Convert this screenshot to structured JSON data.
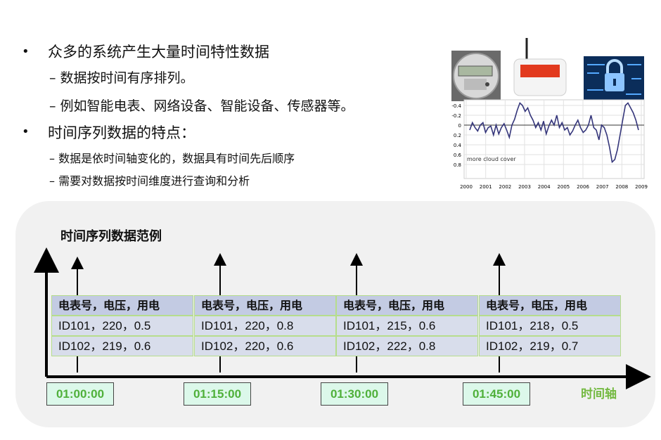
{
  "bullets": [
    {
      "level": 1,
      "text": "众多的系统产生大量时间特性数据"
    },
    {
      "level": 2,
      "text": "– 数据按时间有序排列。"
    },
    {
      "level": 2,
      "text": "– 例如智能电表、网络设备、智能设备、传感器等。"
    },
    {
      "level": 1,
      "text": "时间序列数据的特点："
    },
    {
      "level": 3,
      "text": "– 数据是依时间轴变化的，数据具有时间先后顺序"
    },
    {
      "level": 3,
      "text": "– 需要对数据按时间维度进行查询和分析"
    }
  ],
  "bullet_char": "•",
  "mini_chart": {
    "annotation": "more cloud cover",
    "y_ticks": [
      "-0.4",
      "-0.2",
      "0",
      "0.2",
      "0.4",
      "0.6",
      "0.8"
    ],
    "x_ticks": [
      "2000",
      "2001",
      "2002",
      "2003",
      "2004",
      "2005",
      "2006",
      "2007",
      "2008",
      "2009"
    ],
    "series": [
      0.1,
      -0.05,
      0.05,
      0.12,
      0.0,
      -0.05,
      0.15,
      0.05,
      0.02,
      0.2,
      0.0,
      0.18,
      0.05,
      -0.03,
      0.1,
      0.25,
      0.0,
      -0.12,
      -0.3,
      -0.45,
      -0.4,
      -0.28,
      -0.35,
      -0.2,
      -0.1,
      0.05,
      -0.05,
      0.1,
      -0.08,
      0.18,
      0.02,
      -0.1,
      0.0,
      -0.2,
      0.05,
      -0.05,
      0.1,
      0.05,
      0.2,
      0.12,
      0.0,
      -0.1,
      0.05,
      0.15,
      0.1,
      0.0,
      -0.2,
      0.05,
      0.1,
      0.3,
      0.0,
      0.05,
      0.2,
      0.45,
      0.75,
      0.7,
      0.5,
      0.2,
      -0.1,
      -0.4,
      -0.45,
      -0.35,
      -0.25,
      -0.1,
      0.1
    ]
  },
  "section_title": "时间序列数据范例",
  "axis_label": "时间轴",
  "blocks": [
    {
      "header": "电表号，电压，用电",
      "rows": [
        "ID101，220，0.5",
        "ID102，219，0.6"
      ],
      "time": "01:00:00"
    },
    {
      "header": "电表号，电压，用电",
      "rows": [
        "ID101，220，0.8",
        "ID102，220，0.6"
      ],
      "time": "01:15:00"
    },
    {
      "header": "电表号，电压，用电",
      "rows": [
        "ID101，215，0.6",
        "ID102，222，0.8"
      ],
      "time": "01:30:00"
    },
    {
      "header": "电表号，电压，用电",
      "rows": [
        "ID101，218，0.5",
        "ID102，219，0.7"
      ],
      "time": "01:45:00"
    }
  ]
}
